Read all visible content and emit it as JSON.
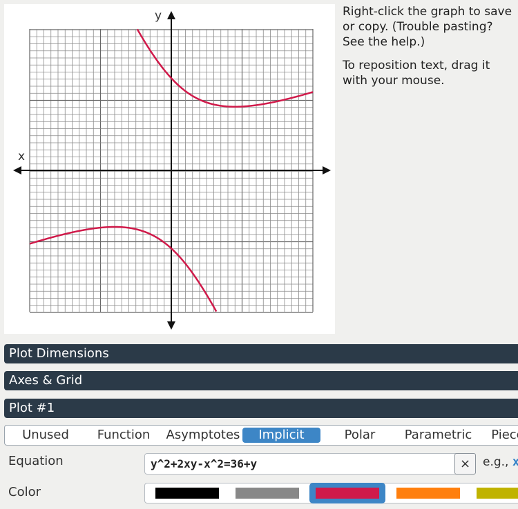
{
  "graph": {
    "x_axis_label": "x",
    "y_axis_label": "y",
    "grid_range": [
      -10,
      10
    ],
    "curve_color": "#d01a4a",
    "equation_plotted": "y^2+2xy-x^2=36+y"
  },
  "help": {
    "line1": "Right-click the graph to save or copy. (Trouble pasting? See the help.)",
    "line2": "To reposition text, drag it with your mouse."
  },
  "sections": {
    "plot_dimensions": "Plot Dimensions",
    "axes_grid": "Axes & Grid",
    "plot_1": "Plot #1"
  },
  "plot_types": {
    "tabs": [
      "Unused",
      "Function",
      "Asymptotes",
      "Implicit",
      "Polar",
      "Parametric",
      "Piece"
    ],
    "active": "Implicit"
  },
  "equation": {
    "label": "Equation",
    "value": "y^2+2xy-x^2=36+y",
    "clear_label": "×",
    "example_prefix": "e.g., ",
    "example_code": "x"
  },
  "color": {
    "label": "Color",
    "swatches": [
      "#000000",
      "#888888",
      "#d01a4a",
      "#ff7f0e",
      "#c0b300"
    ],
    "selected": "#d01a4a"
  }
}
